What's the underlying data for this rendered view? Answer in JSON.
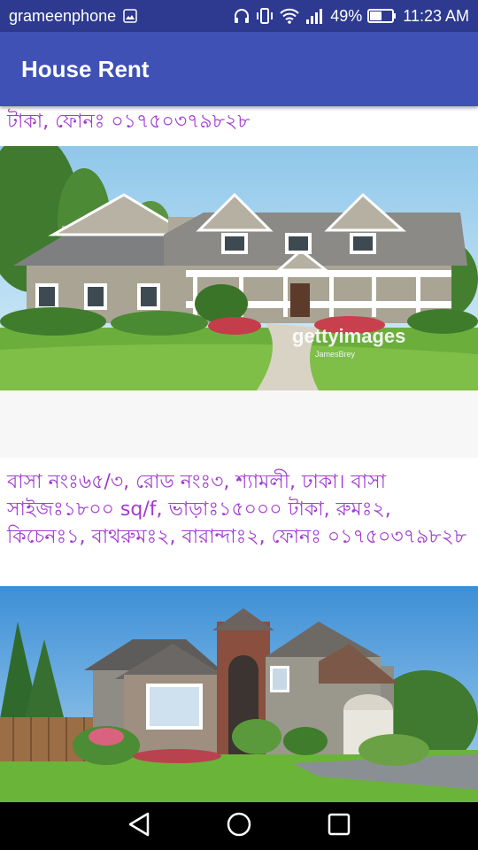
{
  "status_bar": {
    "carrier": "grameenphone",
    "battery": "49%",
    "time": "11:23 AM",
    "icons": [
      "image-icon",
      "headphones-icon",
      "vibrate-icon",
      "wifi-icon",
      "signal-icon",
      "battery-icon"
    ]
  },
  "app_bar": {
    "title": "House Rent"
  },
  "listings": [
    {
      "text": "টাকা, ফোনঃ ০১৭৫০৩৭৯৮২৮",
      "image_watermark": "gettyimages",
      "image_credit": "JamesBrey"
    },
    {
      "text": "বাসা নংঃ৬৫/৩, রোড নংঃ৩, শ্যামলী, ঢাকা। বাসা সাইজঃ১৮০০ sq/f, ভাড়াঃ১৫০০০ টাকা, রুমঃ২, কিচেনঃ১, বাথরুমঃ২, বারান্দাঃ২, ফোনঃ ০১৭৫০৩৭৯৮২৮"
    }
  ],
  "navigation": {
    "buttons": [
      "back-icon",
      "home-icon",
      "recents-icon"
    ]
  },
  "colors": {
    "status_bar": "#2e3a8f",
    "app_bar": "#3f51b5",
    "listing_text": "#a23ad1",
    "nav_bar": "#000000"
  }
}
